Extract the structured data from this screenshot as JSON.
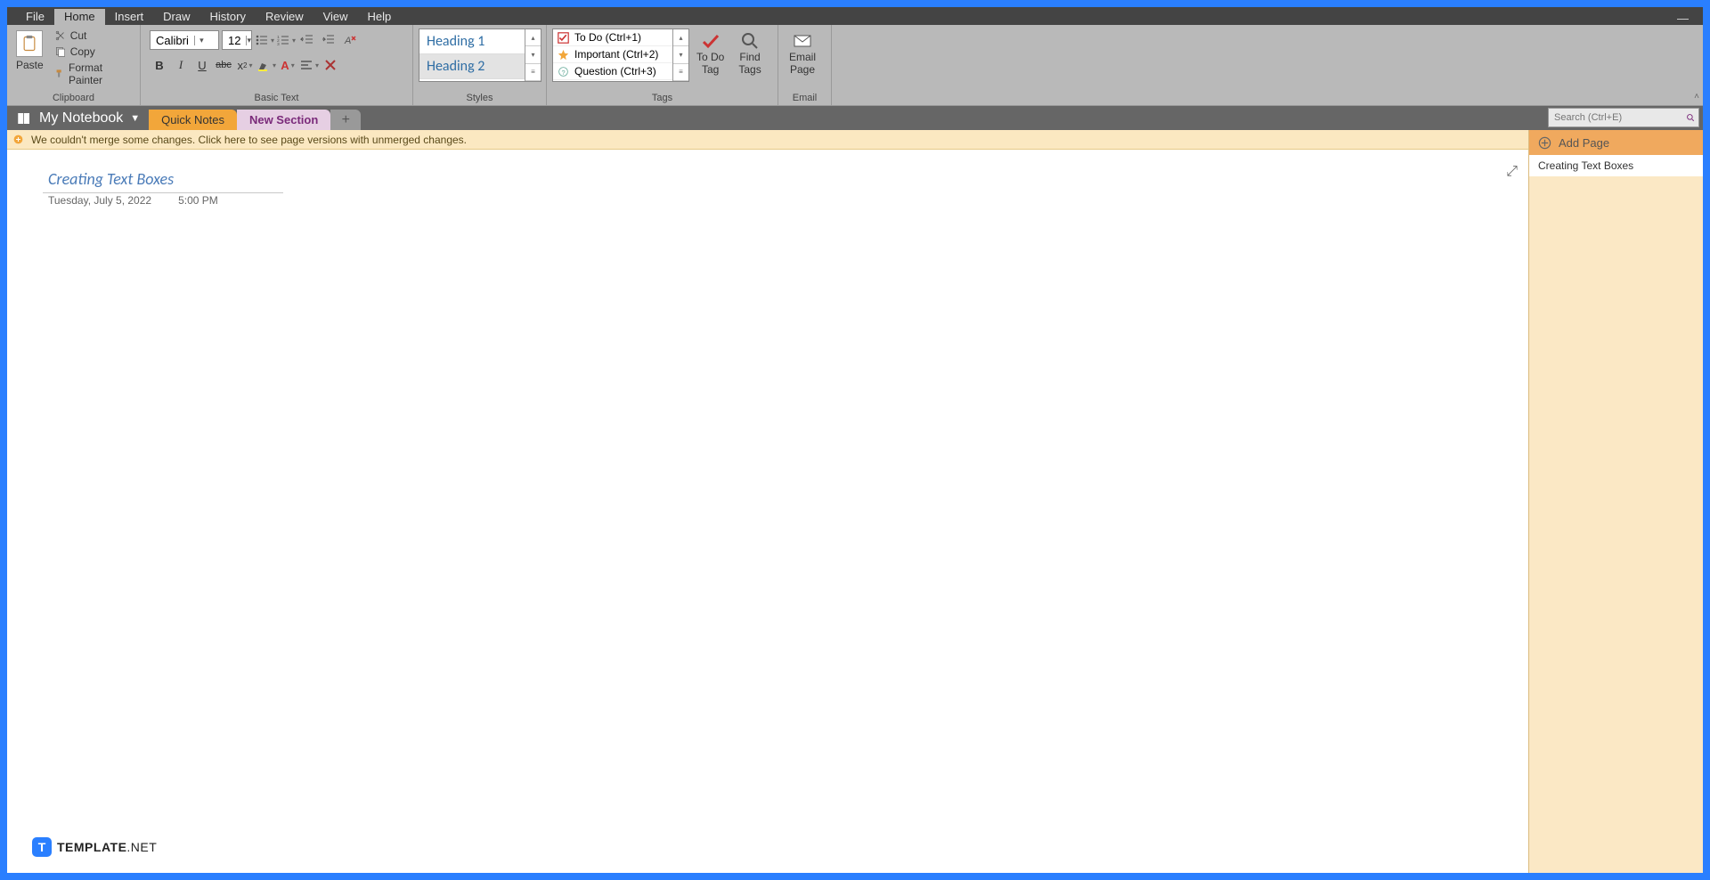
{
  "menu": {
    "file": "File",
    "home": "Home",
    "insert": "Insert",
    "draw": "Draw",
    "history": "History",
    "review": "Review",
    "view": "View",
    "help": "Help"
  },
  "ribbon": {
    "paste": "Paste",
    "cut": "Cut",
    "copy": "Copy",
    "format_painter": "Format Painter",
    "clipboard_label": "Clipboard",
    "font_name": "Calibri",
    "font_size": "12",
    "basic_text_label": "Basic Text",
    "style1": "Heading 1",
    "style2": "Heading 2",
    "styles_label": "Styles",
    "tag1": "To Do (Ctrl+1)",
    "tag2": "Important (Ctrl+2)",
    "tag3": "Question (Ctrl+3)",
    "tags_label": "Tags",
    "todo1": "To Do",
    "todo2": "Tag",
    "find1": "Find",
    "find2": "Tags",
    "email1": "Email",
    "email2": "Page",
    "email_label": "Email"
  },
  "nav": {
    "notebook": "My Notebook",
    "quick": "Quick Notes",
    "newsec": "New Section",
    "search_ph": "Search (Ctrl+E)"
  },
  "warn": "We couldn't merge some changes. Click here to see page versions with unmerged changes.",
  "page": {
    "title": "Creating Text Boxes",
    "date": "Tuesday, July 5, 2022",
    "time": "5:00 PM"
  },
  "panel": {
    "add": "Add Page",
    "item1": "Creating Text Boxes"
  },
  "watermark": "TEMPLATE.NET"
}
